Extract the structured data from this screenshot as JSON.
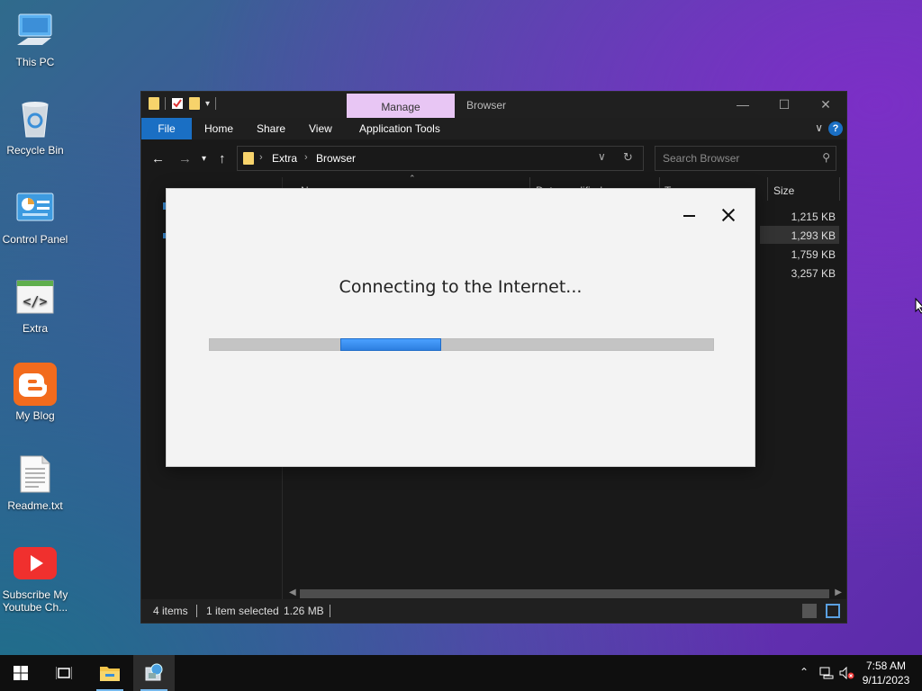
{
  "desktop": {
    "icons": [
      {
        "label": "This PC"
      },
      {
        "label": "Recycle Bin"
      },
      {
        "label": "Control Panel"
      },
      {
        "label": "Extra"
      },
      {
        "label": "My Blog"
      },
      {
        "label": "Readme.txt"
      },
      {
        "label": "Subscribe My Youtube Ch..."
      }
    ]
  },
  "explorer": {
    "title": "Browser",
    "contextual_tab": "Manage",
    "ribbon_tabs": {
      "file": "File",
      "home": "Home",
      "share": "Share",
      "view": "View",
      "app_tools": "Application Tools"
    },
    "breadcrumb": [
      "Extra",
      "Browser"
    ],
    "search_placeholder": "Search Browser",
    "columns": {
      "name": "Name",
      "date": "Date modified",
      "type": "Type",
      "size": "Size"
    },
    "sizes": [
      "1,215 KB",
      "1,293 KB",
      "1,759 KB",
      "3,257 KB"
    ],
    "status": {
      "items": "4 items",
      "selected": "1 item selected",
      "selected_size": "1.26 MB"
    }
  },
  "dialog": {
    "message": "Connecting to the Internet...",
    "progress_segment": {
      "start": 0.26,
      "end": 0.46
    }
  },
  "taskbar": {
    "time": "7:58 AM",
    "date": "9/11/2023"
  },
  "colors": {
    "accent": "#1a6fc4",
    "manage_tab": "#e8c6f4",
    "progress_fill": "#2d7fe0"
  }
}
